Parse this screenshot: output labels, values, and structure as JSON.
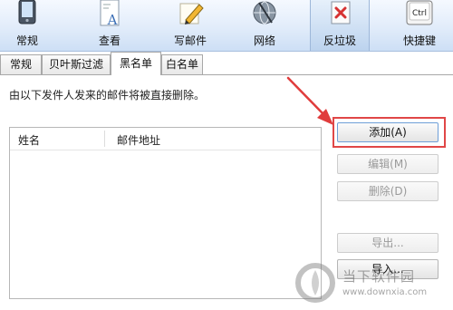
{
  "toolbar": {
    "items": [
      {
        "label": "常规",
        "icon": "phone-icon"
      },
      {
        "label": "查看",
        "icon": "document-font-icon"
      },
      {
        "label": "写邮件",
        "icon": "pencil-icon"
      },
      {
        "label": "网络",
        "icon": "globe-icon"
      },
      {
        "label": "反垃圾",
        "icon": "antispam-icon"
      },
      {
        "label": "快捷键",
        "icon": "ctrl-key-icon"
      }
    ],
    "ctrl_key_text": "Ctrl",
    "active_index": 4
  },
  "tabs": [
    {
      "label": "常规"
    },
    {
      "label": "贝叶斯过滤"
    },
    {
      "label": "黑名单"
    },
    {
      "label": "白名单"
    }
  ],
  "active_tab_index": 2,
  "description": "由以下发件人发来的邮件将被直接删除。",
  "list": {
    "columns": [
      "姓名",
      "邮件地址"
    ],
    "rows": []
  },
  "buttons": {
    "add": "添加(A)",
    "edit": "编辑(M)",
    "delete": "删除(D)",
    "export": "导出...",
    "import": "导入..."
  },
  "watermark": {
    "text": "当下软件园",
    "url": "www.downxia.com"
  },
  "colors": {
    "highlight": "#e04747",
    "arrow": "#e03c3c",
    "toolbar_bg": "#dbe8f8"
  }
}
